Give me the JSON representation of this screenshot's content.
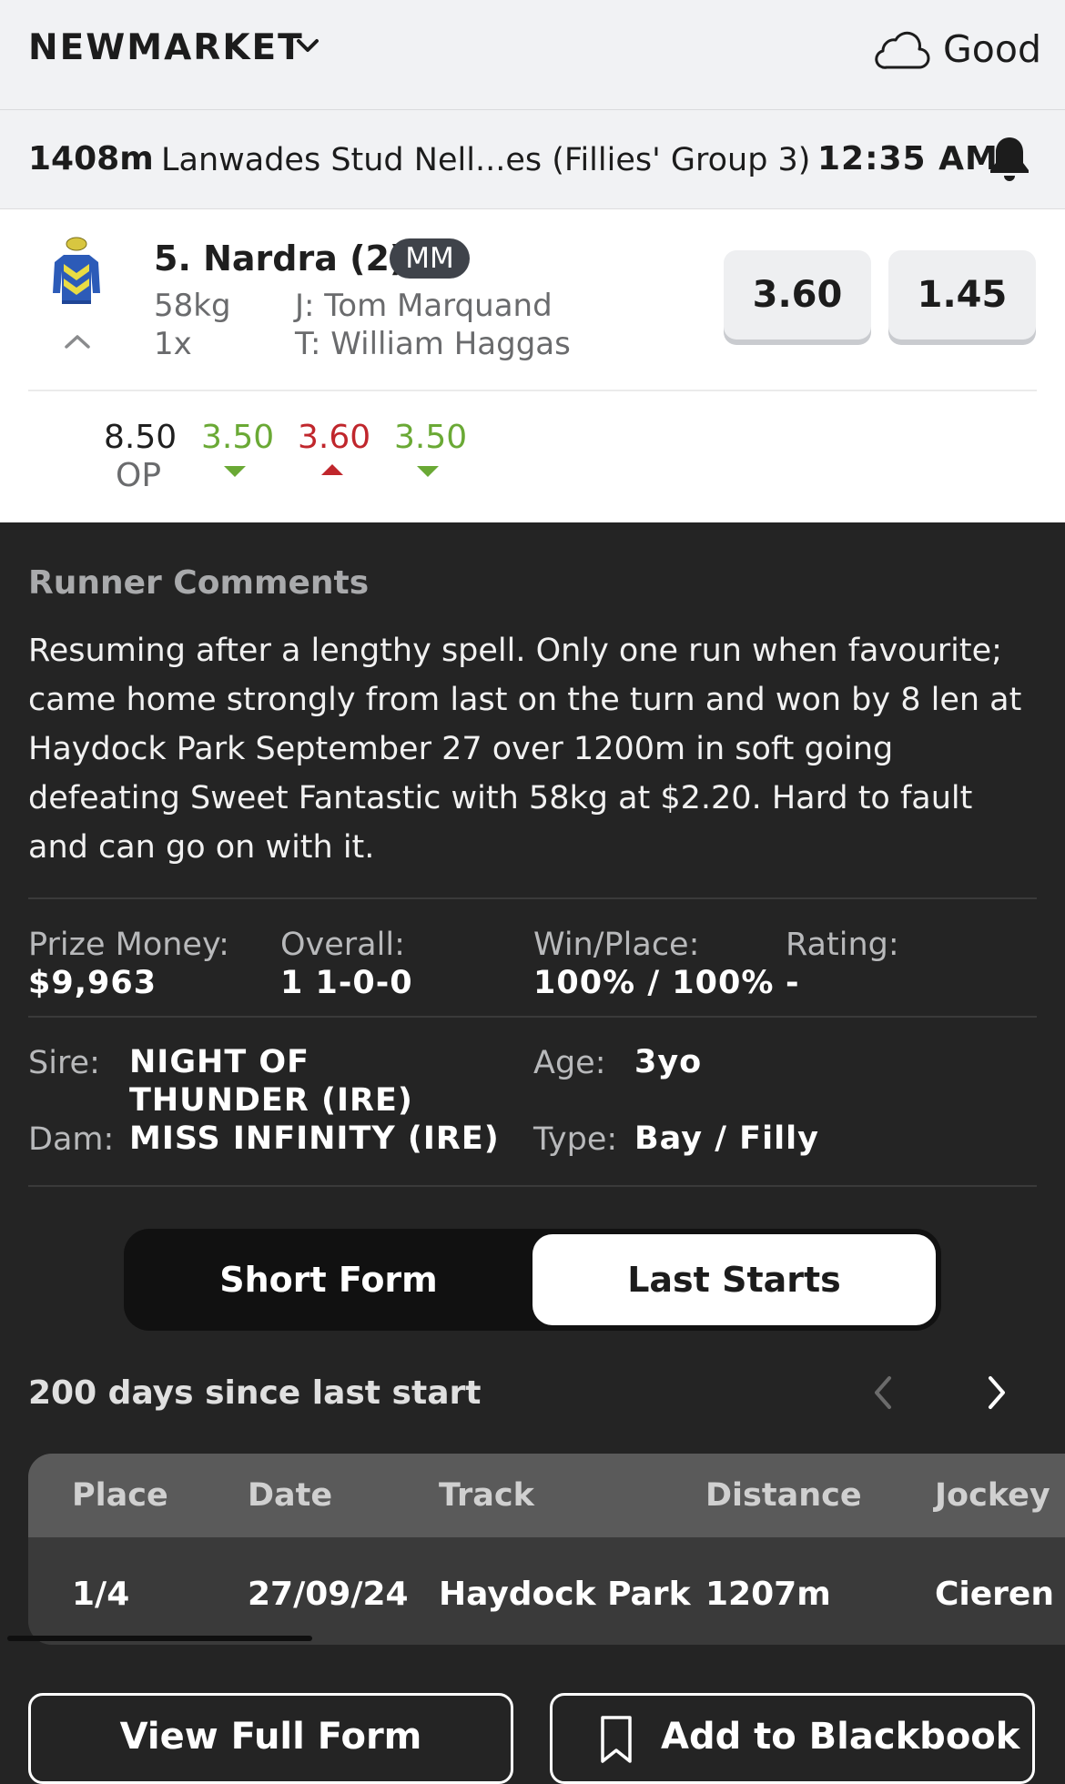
{
  "header": {
    "venue": "NEWMARKET",
    "track_condition": "Good"
  },
  "race": {
    "distance": "1408m",
    "name": "Lanwades Stud Nell...es (Fillies' Group 3)",
    "time": "12:35 AM"
  },
  "runner": {
    "name": "5. Nardra (2)",
    "badge": "MM",
    "weight": "58kg",
    "jockey": "J: Tom Marquand",
    "form_count": "1x",
    "trainer": "T: William Haggas",
    "odds_win": "3.60",
    "odds_place": "1.45",
    "flucs": [
      {
        "value": "8.50",
        "label": "OP",
        "trend": "none"
      },
      {
        "value": "3.50",
        "label": "",
        "trend": "down"
      },
      {
        "value": "3.60",
        "label": "",
        "trend": "up"
      },
      {
        "value": "3.50",
        "label": "",
        "trend": "down"
      }
    ]
  },
  "colors": {
    "fluc_down": "#6aa935",
    "fluc_up": "#c0262c",
    "dark_bg": "#242424",
    "header_bg": "#f1f2f4"
  },
  "comments": {
    "title": "Runner Comments",
    "text": "Resuming after a lengthy spell. Only one run when favourite; came home strongly from last on the turn and won by 8 len at Haydock Park September 27 over 1200m in soft going defeating Sweet Fantastic with 58kg at $2.20. Hard to fault and can go on with it."
  },
  "stats": {
    "prize_label": "Prize Money:",
    "prize_value": "$9,963",
    "overall_label": "Overall:",
    "overall_value": "1 1-0-0",
    "winplace_label": "Win/Place:",
    "winplace_value": "100% / 100%",
    "rating_label": "Rating:",
    "rating_value": "-"
  },
  "pedigree": {
    "sire_label": "Sire:",
    "sire_value": "NIGHT OF THUNDER (IRE)",
    "dam_label": "Dam:",
    "dam_value": "MISS INFINITY (IRE)",
    "age_label": "Age:",
    "age_value": "3yo",
    "type_label": "Type:",
    "type_value": "Bay / Filly"
  },
  "form_tabs": {
    "short_form": "Short Form",
    "last_starts": "Last Starts",
    "selected": "Last Starts"
  },
  "last_starts": {
    "days_since": "200 days since last start",
    "columns": [
      "Place",
      "Date",
      "Track",
      "Distance",
      "Jockey"
    ],
    "rows": [
      [
        "1/4",
        "27/09/24",
        "Haydock Park",
        "1207m",
        "Cieren F"
      ]
    ]
  },
  "actions": {
    "view_full_form": "View Full Form",
    "add_blackbook": "Add to Blackbook"
  },
  "icons": [
    "chevron-down-icon",
    "cloud-icon",
    "bell-icon",
    "jockey-silks-icon",
    "chevron-up-icon",
    "chevron-left-icon",
    "chevron-right-icon",
    "bookmark-icon"
  ]
}
